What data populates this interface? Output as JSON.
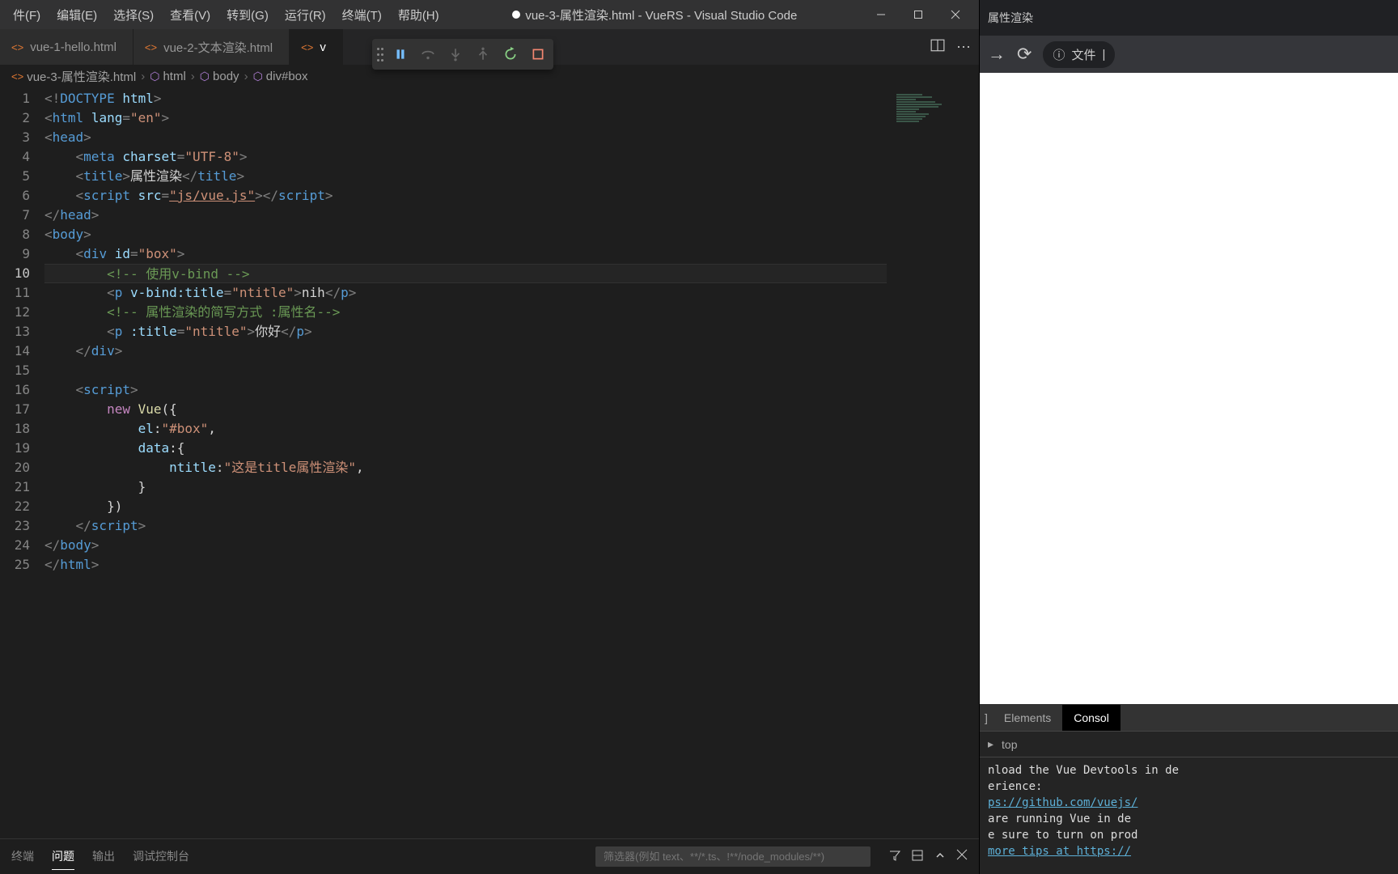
{
  "titlebar": {
    "menu": [
      "件(F)",
      "编辑(E)",
      "选择(S)",
      "查看(V)",
      "转到(G)",
      "运行(R)",
      "终端(T)",
      "帮助(H)"
    ],
    "title": "vue-3-属性渲染.html - VueRS - Visual Studio Code"
  },
  "tabs": [
    {
      "label": "vue-1-hello.html",
      "active": false
    },
    {
      "label": "vue-2-文本渲染.html",
      "active": false
    },
    {
      "label": "v",
      "active": true
    }
  ],
  "editor_actions": {
    "split": "⫿⫿",
    "more": "···"
  },
  "breadcrumb": [
    {
      "icon": "file",
      "label": "vue-3-属性渲染.html"
    },
    {
      "icon": "cube",
      "label": "html"
    },
    {
      "icon": "cube",
      "label": "body"
    },
    {
      "icon": "cube",
      "label": "div#box"
    }
  ],
  "code": {
    "lines": [
      {
        "n": 1,
        "seg": [
          [
            "p",
            "<!"
          ],
          [
            "t",
            "DOCTYPE "
          ],
          [
            "a",
            "html"
          ],
          [
            "p",
            ">"
          ]
        ]
      },
      {
        "n": 2,
        "seg": [
          [
            "p",
            "<"
          ],
          [
            "t",
            "html "
          ],
          [
            "a",
            "lang"
          ],
          [
            "p",
            "="
          ],
          [
            "s",
            "\"en\""
          ],
          [
            "p",
            ">"
          ]
        ]
      },
      {
        "n": 3,
        "seg": [
          [
            "p",
            "<"
          ],
          [
            "t",
            "head"
          ],
          [
            "p",
            ">"
          ]
        ]
      },
      {
        "n": 4,
        "seg": [
          [
            "d",
            "    "
          ],
          [
            "p",
            "<"
          ],
          [
            "t",
            "meta "
          ],
          [
            "a",
            "charset"
          ],
          [
            "p",
            "="
          ],
          [
            "s",
            "\"UTF-8\""
          ],
          [
            "p",
            ">"
          ]
        ]
      },
      {
        "n": 5,
        "seg": [
          [
            "d",
            "    "
          ],
          [
            "p",
            "<"
          ],
          [
            "t",
            "title"
          ],
          [
            "p",
            ">"
          ],
          [
            "d",
            "属性渲染"
          ],
          [
            "p",
            "</"
          ],
          [
            "t",
            "title"
          ],
          [
            "p",
            ">"
          ]
        ]
      },
      {
        "n": 6,
        "seg": [
          [
            "d",
            "    "
          ],
          [
            "p",
            "<"
          ],
          [
            "t",
            "script "
          ],
          [
            "a",
            "src"
          ],
          [
            "p",
            "="
          ],
          [
            "s underline",
            "\"js/vue.js\""
          ],
          [
            "p",
            "></"
          ],
          [
            "t",
            "script"
          ],
          [
            "p",
            ">"
          ]
        ]
      },
      {
        "n": 7,
        "seg": [
          [
            "p",
            "</"
          ],
          [
            "t",
            "head"
          ],
          [
            "p",
            ">"
          ]
        ]
      },
      {
        "n": 8,
        "seg": [
          [
            "p",
            "<"
          ],
          [
            "t",
            "body"
          ],
          [
            "p",
            ">"
          ]
        ]
      },
      {
        "n": 9,
        "seg": [
          [
            "d",
            "    "
          ],
          [
            "p",
            "<"
          ],
          [
            "t",
            "div "
          ],
          [
            "a",
            "id"
          ],
          [
            "p",
            "="
          ],
          [
            "s",
            "\"box\""
          ],
          [
            "p",
            ">"
          ]
        ]
      },
      {
        "n": 10,
        "active": true,
        "seg": [
          [
            "d",
            "        "
          ],
          [
            "c",
            "<!-- 使用v-bind -->"
          ]
        ]
      },
      {
        "n": 11,
        "seg": [
          [
            "d",
            "        "
          ],
          [
            "p",
            "<"
          ],
          [
            "t",
            "p "
          ],
          [
            "a",
            "v-bind:title"
          ],
          [
            "p",
            "="
          ],
          [
            "s",
            "\"ntitle\""
          ],
          [
            "p",
            ">"
          ],
          [
            "d",
            "nih"
          ],
          [
            "p",
            "</"
          ],
          [
            "t",
            "p"
          ],
          [
            "p",
            ">"
          ]
        ]
      },
      {
        "n": 12,
        "seg": [
          [
            "d",
            "        "
          ],
          [
            "c",
            "<!-- 属性渲染的简写方式 :属性名-->"
          ]
        ]
      },
      {
        "n": 13,
        "seg": [
          [
            "d",
            "        "
          ],
          [
            "p",
            "<"
          ],
          [
            "t",
            "p "
          ],
          [
            "a",
            ":title"
          ],
          [
            "p",
            "="
          ],
          [
            "s",
            "\"ntitle\""
          ],
          [
            "p",
            ">"
          ],
          [
            "d",
            "你好"
          ],
          [
            "p",
            "</"
          ],
          [
            "t",
            "p"
          ],
          [
            "p",
            ">"
          ]
        ]
      },
      {
        "n": 14,
        "seg": [
          [
            "d",
            "    "
          ],
          [
            "p",
            "</"
          ],
          [
            "t",
            "div"
          ],
          [
            "p",
            ">"
          ]
        ]
      },
      {
        "n": 15,
        "seg": [
          [
            "d",
            ""
          ]
        ]
      },
      {
        "n": 16,
        "seg": [
          [
            "d",
            "    "
          ],
          [
            "p",
            "<"
          ],
          [
            "t",
            "script"
          ],
          [
            "p",
            ">"
          ]
        ]
      },
      {
        "n": 17,
        "seg": [
          [
            "d",
            "        "
          ],
          [
            "k",
            "new "
          ],
          [
            "f",
            "Vue"
          ],
          [
            "d",
            "({"
          ]
        ]
      },
      {
        "n": 18,
        "seg": [
          [
            "d",
            "            "
          ],
          [
            "a",
            "el"
          ],
          [
            "d",
            ":"
          ],
          [
            "s",
            "\"#box\""
          ],
          [
            "d",
            ","
          ]
        ]
      },
      {
        "n": 19,
        "seg": [
          [
            "d",
            "            "
          ],
          [
            "a",
            "data"
          ],
          [
            "d",
            ":{"
          ]
        ]
      },
      {
        "n": 20,
        "seg": [
          [
            "d",
            "                "
          ],
          [
            "a",
            "ntitle"
          ],
          [
            "d",
            ":"
          ],
          [
            "s",
            "\"这是title属性渲染\""
          ],
          [
            "d",
            ","
          ]
        ]
      },
      {
        "n": 21,
        "seg": [
          [
            "d",
            "            }"
          ]
        ]
      },
      {
        "n": 22,
        "seg": [
          [
            "d",
            "        })"
          ]
        ]
      },
      {
        "n": 23,
        "seg": [
          [
            "d",
            "    "
          ],
          [
            "p",
            "</"
          ],
          [
            "t",
            "script"
          ],
          [
            "p",
            ">"
          ]
        ]
      },
      {
        "n": 24,
        "seg": [
          [
            "p",
            "</"
          ],
          [
            "t",
            "body"
          ],
          [
            "p",
            ">"
          ]
        ]
      },
      {
        "n": 25,
        "seg": [
          [
            "p",
            "</"
          ],
          [
            "t",
            "html"
          ],
          [
            "p",
            ">"
          ]
        ]
      }
    ]
  },
  "panel": {
    "tabs": [
      "终端",
      "问题",
      "输出",
      "调试控制台"
    ],
    "active": 1,
    "filter_placeholder": "筛选器(例如 text、**/*.ts、!**/node_modules/**)"
  },
  "browser": {
    "tab_title": "属性渲染",
    "addr_label": "文件",
    "devtools": {
      "tabs": [
        "Elements",
        "Consol"
      ],
      "filter_dropdown": "top",
      "console_lines": [
        "nload the Vue Devtools in de",
        "erience:",
        "ps://github.com/vuejs/",
        "",
        " are running Vue in de",
        "e sure to turn on prod",
        " more tips at https://"
      ]
    }
  }
}
